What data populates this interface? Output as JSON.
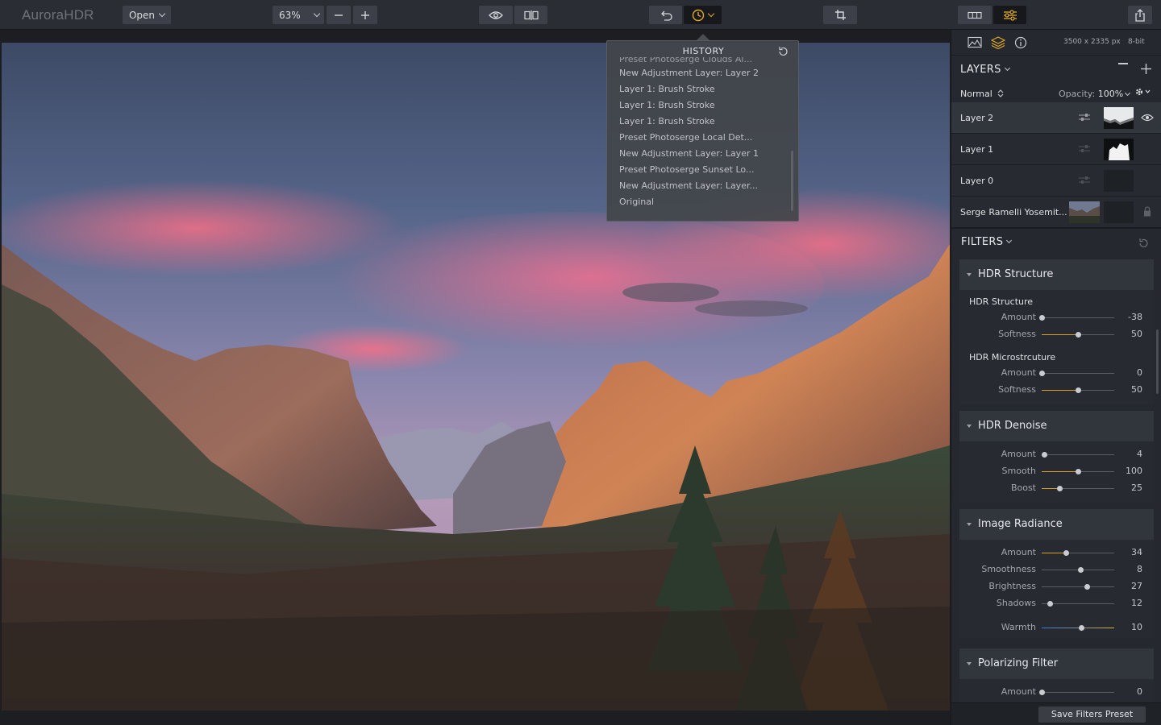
{
  "app": {
    "logo": "AuroraHDR"
  },
  "toolbar": {
    "open_label": "Open",
    "zoom_value": "63%"
  },
  "history": {
    "title": "HISTORY",
    "cut_item": "Preset Photoserge Clouds Al...",
    "items": [
      "New Adjustment Layer: Layer 2",
      "Layer 1: Brush Stroke",
      "Layer 1: Brush Stroke",
      "Layer 1: Brush Stroke",
      "Preset Photoserge Local Det...",
      "New Adjustment Layer: Layer 1",
      "Preset Photoserge Sunset Lo...",
      "New Adjustment Layer: Layer...",
      "Original"
    ]
  },
  "panel": {
    "dimensions": "3500 x 2335 px",
    "bit_depth": "8-bit",
    "layers_title": "LAYERS",
    "blend_mode": "Normal",
    "opacity_label": "Opacity:",
    "opacity_value": "100%",
    "layers": [
      {
        "name": "Layer 2"
      },
      {
        "name": "Layer 1"
      },
      {
        "name": "Layer 0"
      },
      {
        "name": "Serge Ramelli Yosemit..."
      }
    ],
    "filters_title": "FILTERS"
  },
  "filters": {
    "hdr_structure": {
      "title": "HDR Structure",
      "sub1": "HDR Structure",
      "s1_amount": {
        "label": "Amount",
        "value": "-38",
        "pos": 0.0
      },
      "s1_softness": {
        "label": "Softness",
        "value": "50",
        "pos": 0.5
      },
      "sub2": "HDR Microstrcuture",
      "s2_amount": {
        "label": "Amount",
        "value": "0",
        "pos": 0.0
      },
      "s2_softness": {
        "label": "Softness",
        "value": "50",
        "pos": 0.5
      }
    },
    "hdr_denoise": {
      "title": "HDR Denoise",
      "amount": {
        "label": "Amount",
        "value": "4",
        "pos": 0.04
      },
      "smooth": {
        "label": "Smooth",
        "value": "100",
        "pos": 0.5
      },
      "boost": {
        "label": "Boost",
        "value": "25",
        "pos": 0.25
      }
    },
    "image_radiance": {
      "title": "Image Radiance",
      "amount": {
        "label": "Amount",
        "value": "34",
        "pos": 0.34
      },
      "smoothness": {
        "label": "Smoothness",
        "value": "8",
        "pos": 0.54
      },
      "brightness": {
        "label": "Brightness",
        "value": "27",
        "pos": 0.63
      },
      "shadows": {
        "label": "Shadows",
        "value": "12",
        "pos": 0.12
      },
      "warmth": {
        "label": "Warmth",
        "value": "10",
        "pos": 0.55
      }
    },
    "polarizing": {
      "title": "Polarizing Filter",
      "amount": {
        "label": "Amount",
        "value": "0",
        "pos": 0.0
      }
    }
  },
  "footer": {
    "save_label": "Save Filters Preset"
  }
}
